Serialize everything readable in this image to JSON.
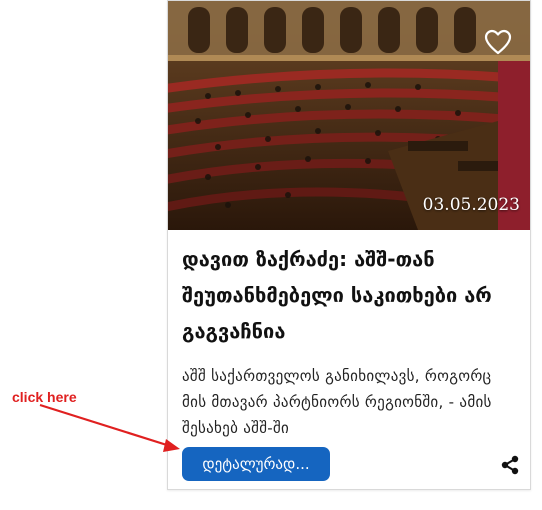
{
  "card": {
    "date": "03.05.2023",
    "title": "დავით ზაქრაძე: აშშ-თან შეუთანხმებელი საკითხები არ გაგვაჩნია",
    "excerpt": "აშშ საქართველოს განიხილავს, როგორც მის მთავარ პარტნიორს რეგიონში, - ამის შესახებ აშშ-ში",
    "details_button_label": "დეტალურად...",
    "favorite_icon": "heart-outline-icon",
    "share_icon": "share-icon"
  },
  "annotation": {
    "label": "click here",
    "color": "#e02020"
  },
  "colors": {
    "button": "#1565c0",
    "annotation": "#e02020"
  }
}
